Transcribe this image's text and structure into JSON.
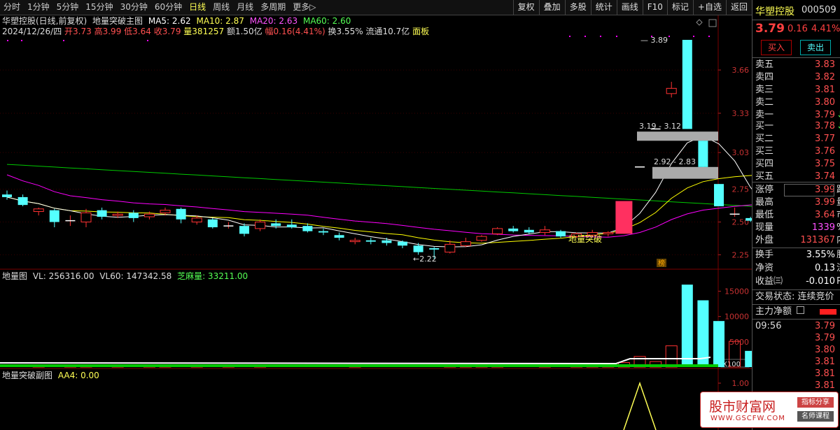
{
  "toolbar": {
    "periods": [
      "分时",
      "1分钟",
      "5分钟",
      "15分钟",
      "30分钟",
      "60分钟",
      "日线",
      "周线",
      "月线",
      "多周期",
      "更多▷"
    ],
    "active_period": "日线",
    "tools": [
      "复权",
      "叠加",
      "多股",
      "统计",
      "画线",
      "F10",
      "标记",
      "+自选",
      "返回"
    ]
  },
  "main_info": {
    "line1_name": "华塑控股(日线,前复权)",
    "line1_indicator": "地量突破主图",
    "ma5": "MA5: 2.62",
    "ma10": "MA10: 2.87",
    "ma20": "MA20: 2.63",
    "ma60": "MA60: 2.60",
    "line2_date": "2024/12/26/四",
    "line2_open": "开3.73",
    "line2_high": "高3.99",
    "line2_low": "低3.64",
    "line2_close": "收3.79",
    "line2_vol": "量381257",
    "line2_amount": "额1.50亿",
    "line2_change": "幅0.16(4.41%)",
    "line2_turnover": "换3.55%",
    "line2_float": "流通10.7亿",
    "line2_panel": "面板"
  },
  "annotations": {
    "high_label": "3.89",
    "gap1": "3.19 - 3.12",
    "gap2": "2.92 - 2.83",
    "low_label": "2.22",
    "breakout": "地量突破",
    "bang": "榜"
  },
  "price_axis": [
    "3.66",
    "3.33",
    "3.03",
    "2.75",
    "2.50",
    "2.25"
  ],
  "vol_info": {
    "name": "地量图",
    "vl": "VL: 256316.00",
    "vl60": "VL60: 147342.58",
    "zm": "芝麻量: 33211.00"
  },
  "vol_axis": [
    "15000",
    "10000",
    "5000"
  ],
  "vol_unit": "X100",
  "sub_info": {
    "name": "地量突破副图",
    "aa4": "AA4: 0.00"
  },
  "sub_axis": [
    "1.00"
  ],
  "panel": {
    "name": "华塑控股",
    "code": "000509",
    "price": "3.79",
    "change": "0.16",
    "pct": "4.41%",
    "buy_btn": "买入",
    "sell_btn": "卖出",
    "sells": [
      {
        "label": "卖五",
        "price": "3.83",
        "mark": ""
      },
      {
        "label": "卖四",
        "price": "3.82",
        "mark": ""
      },
      {
        "label": "卖三",
        "price": "3.81",
        "mark": ""
      },
      {
        "label": "卖二",
        "price": "3.80",
        "mark": ""
      },
      {
        "label": "卖一",
        "price": "3.79",
        "mark": "↓"
      }
    ],
    "buys": [
      {
        "label": "买一",
        "price": "3.78",
        "mark": "↓"
      },
      {
        "label": "买二",
        "price": "3.77",
        "mark": ""
      },
      {
        "label": "买三",
        "price": "3.76",
        "mark": ""
      },
      {
        "label": "买四",
        "price": "3.75",
        "mark": ""
      },
      {
        "label": "买五",
        "price": "3.74",
        "mark": ""
      }
    ],
    "stats": [
      {
        "label": "涨停",
        "value": "3.99",
        "tail": "跌",
        "color": "#ff5050"
      },
      {
        "label": "最高",
        "value": "3.99",
        "tail": "量",
        "color": "#ff5050"
      },
      {
        "label": "最低",
        "value": "3.64",
        "tail": "市",
        "color": "#ff5050"
      },
      {
        "label": "现量",
        "value": "1339",
        "tail": "%",
        "color": "#ff50ff"
      },
      {
        "label": "外盘",
        "value": "131367",
        "tail": "内",
        "color": "#ff5050"
      }
    ],
    "stats2": [
      {
        "label": "换手",
        "value": "3.55%",
        "tail": "股",
        "color": "#ffffff"
      },
      {
        "label": "净资",
        "value": "0.13",
        "tail": "流",
        "color": "#ffffff"
      },
      {
        "label": "收益㈢",
        "value": "-0.010",
        "tail": "P",
        "color": "#ffffff"
      }
    ],
    "trade_state_label": "交易状态:",
    "trade_state_value": "连续竞价",
    "main_flow": "主力净额",
    "ticks": [
      {
        "time": "09:56",
        "price": "3.79"
      },
      {
        "time": "",
        "price": "3.79"
      },
      {
        "time": "",
        "price": "3.80"
      },
      {
        "time": "",
        "price": "3.81"
      },
      {
        "time": "",
        "price": "3.81"
      },
      {
        "time": "",
        "price": "3.81"
      }
    ]
  },
  "watermark": {
    "title": "股市财富网",
    "tag1": "指标分享",
    "tag2": "名师课程",
    "url": "WWW.GSCFW.COM"
  },
  "colors": {
    "up": "#ff3232",
    "down": "#54ffff",
    "ma5": "#ffffff",
    "ma10": "#ffff00",
    "ma20": "#ff00ff",
    "ma60": "#00c800"
  },
  "chart_data": {
    "type": "candlestick",
    "candles": [
      {
        "o": 2.71,
        "h": 2.74,
        "l": 2.67,
        "c": 2.69
      },
      {
        "o": 2.69,
        "h": 2.71,
        "l": 2.62,
        "c": 2.63
      },
      {
        "o": 2.58,
        "h": 2.61,
        "l": 2.55,
        "c": 2.6
      },
      {
        "o": 2.59,
        "h": 2.6,
        "l": 2.46,
        "c": 2.5
      },
      {
        "o": 2.51,
        "h": 2.55,
        "l": 2.47,
        "c": 2.51
      },
      {
        "o": 2.5,
        "h": 2.6,
        "l": 2.46,
        "c": 2.57
      },
      {
        "o": 2.59,
        "h": 2.61,
        "l": 2.52,
        "c": 2.54
      },
      {
        "o": 2.55,
        "h": 2.58,
        "l": 2.53,
        "c": 2.56
      },
      {
        "o": 2.57,
        "h": 2.59,
        "l": 2.5,
        "c": 2.53
      },
      {
        "o": 2.54,
        "h": 2.58,
        "l": 2.52,
        "c": 2.56
      },
      {
        "o": 2.57,
        "h": 2.61,
        "l": 2.55,
        "c": 2.59
      },
      {
        "o": 2.6,
        "h": 2.61,
        "l": 2.49,
        "c": 2.52
      },
      {
        "o": 2.5,
        "h": 2.55,
        "l": 2.48,
        "c": 2.53
      },
      {
        "o": 2.52,
        "h": 2.53,
        "l": 2.45,
        "c": 2.46
      },
      {
        "o": 2.47,
        "h": 2.5,
        "l": 2.45,
        "c": 2.47
      },
      {
        "o": 2.47,
        "h": 2.49,
        "l": 2.39,
        "c": 2.41
      },
      {
        "o": 2.45,
        "h": 2.52,
        "l": 2.43,
        "c": 2.5
      },
      {
        "o": 2.49,
        "h": 2.52,
        "l": 2.45,
        "c": 2.47
      },
      {
        "o": 2.48,
        "h": 2.52,
        "l": 2.45,
        "c": 2.46
      },
      {
        "o": 2.47,
        "h": 2.49,
        "l": 2.42,
        "c": 2.43
      },
      {
        "o": 2.43,
        "h": 2.45,
        "l": 2.4,
        "c": 2.42
      },
      {
        "o": 2.4,
        "h": 2.42,
        "l": 2.36,
        "c": 2.38
      },
      {
        "o": 2.35,
        "h": 2.38,
        "l": 2.33,
        "c": 2.36
      },
      {
        "o": 2.36,
        "h": 2.38,
        "l": 2.33,
        "c": 2.35
      },
      {
        "o": 2.36,
        "h": 2.38,
        "l": 2.32,
        "c": 2.34
      },
      {
        "o": 2.35,
        "h": 2.36,
        "l": 2.3,
        "c": 2.32
      },
      {
        "o": 2.32,
        "h": 2.34,
        "l": 2.25,
        "c": 2.27
      },
      {
        "o": 2.3,
        "h": 2.31,
        "l": 2.22,
        "c": 2.29
      },
      {
        "o": 2.27,
        "h": 2.36,
        "l": 2.26,
        "c": 2.33
      },
      {
        "o": 2.32,
        "h": 2.38,
        "l": 2.31,
        "c": 2.35
      },
      {
        "o": 2.36,
        "h": 2.4,
        "l": 2.35,
        "c": 2.39
      },
      {
        "o": 2.41,
        "h": 2.46,
        "l": 2.4,
        "c": 2.45
      },
      {
        "o": 2.45,
        "h": 2.47,
        "l": 2.42,
        "c": 2.43
      },
      {
        "o": 2.44,
        "h": 2.46,
        "l": 2.41,
        "c": 2.42
      },
      {
        "o": 2.42,
        "h": 2.47,
        "l": 2.4,
        "c": 2.44
      },
      {
        "o": 2.43,
        "h": 2.44,
        "l": 2.38,
        "c": 2.39
      },
      {
        "o": 2.39,
        "h": 2.42,
        "l": 2.38,
        "c": 2.41
      },
      {
        "o": 2.4,
        "h": 2.44,
        "l": 2.39,
        "c": 2.42
      },
      {
        "o": 2.41,
        "h": 2.43,
        "l": 2.39,
        "c": 2.42
      },
      {
        "o": 2.41,
        "h": 2.66,
        "l": 2.41,
        "c": 2.66
      },
      {
        "o": 2.92,
        "h": 2.92,
        "l": 2.92,
        "c": 2.92
      },
      {
        "o": 3.21,
        "h": 3.21,
        "l": 3.21,
        "c": 3.21
      },
      {
        "o": 3.48,
        "h": 3.57,
        "l": 3.45,
        "c": 3.52
      },
      {
        "o": 3.89,
        "h": 3.89,
        "l": 3.21,
        "c": 3.21
      },
      {
        "o": 3.12,
        "h": 3.12,
        "l": 2.92,
        "c": 2.92
      },
      {
        "o": 2.79,
        "h": 2.79,
        "l": 2.62,
        "c": 2.62
      },
      {
        "o": 2.56,
        "h": 2.61,
        "l": 2.54,
        "c": 2.56
      },
      {
        "o": 2.53,
        "h": 2.54,
        "l": 2.5,
        "c": 2.51
      },
      {
        "o": 2.47,
        "h": 2.49,
        "l": 2.45,
        "c": 2.47
      }
    ],
    "volume": [
      400,
      500,
      420,
      380,
      350,
      300,
      420,
      380,
      300,
      350,
      400,
      450,
      320,
      380,
      300,
      420,
      360,
      300,
      350,
      320,
      300,
      350,
      330,
      320,
      280,
      300,
      400,
      350,
      300,
      420,
      500,
      460,
      380,
      400,
      320,
      300,
      350,
      380,
      400,
      900,
      2100,
      1100,
      4200,
      16300,
      13200,
      9100,
      5100,
      3200,
      2300
    ],
    "sub_peak_index": 40
  }
}
